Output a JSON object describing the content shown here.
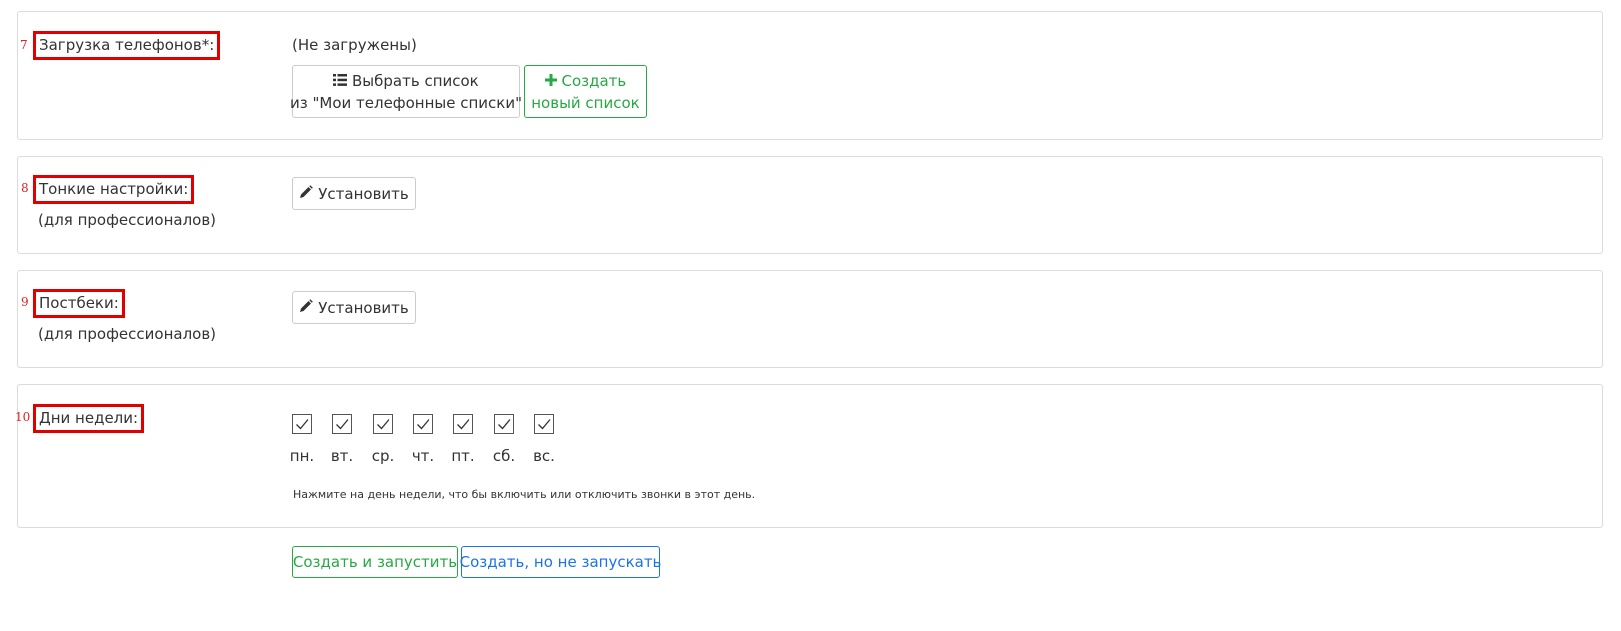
{
  "sections": {
    "phones": {
      "number": "7",
      "label": "Загрузка телефонов*:",
      "status": "(Не загружены)",
      "choose_button": {
        "icon": "list-icon",
        "line1": "Выбрать список",
        "line2": "из \"Мои телефонные списки\""
      },
      "create_button": {
        "icon": "plus-icon",
        "line1": "Создать",
        "line2": "новый список"
      }
    },
    "fine_settings": {
      "number": "8",
      "label": "Тонкие настройки:",
      "sublabel": "(для профессионалов)",
      "button": {
        "icon": "pencil-icon",
        "label": "Установить"
      }
    },
    "postbacks": {
      "number": "9",
      "label": "Постбеки:",
      "sublabel": "(для профессионалов)",
      "button": {
        "icon": "pencil-icon",
        "label": "Установить"
      }
    },
    "weekdays": {
      "number": "10",
      "label": "Дни недели:",
      "days": [
        {
          "label": "пн.",
          "checked": true
        },
        {
          "label": "вт.",
          "checked": true
        },
        {
          "label": "ср.",
          "checked": true
        },
        {
          "label": "чт.",
          "checked": true
        },
        {
          "label": "пт.",
          "checked": true
        },
        {
          "label": "сб.",
          "checked": true
        },
        {
          "label": "вс.",
          "checked": true
        }
      ],
      "hint": "Нажмите на день недели, что бы включить или отключить звонки в этот день."
    }
  },
  "actions": {
    "create_and_start": "Создать и запустить",
    "create_no_start": "Создать, но не запускать"
  },
  "colors": {
    "annotation": "#e00000",
    "green": "#28a745",
    "blue": "#1a73e8"
  }
}
